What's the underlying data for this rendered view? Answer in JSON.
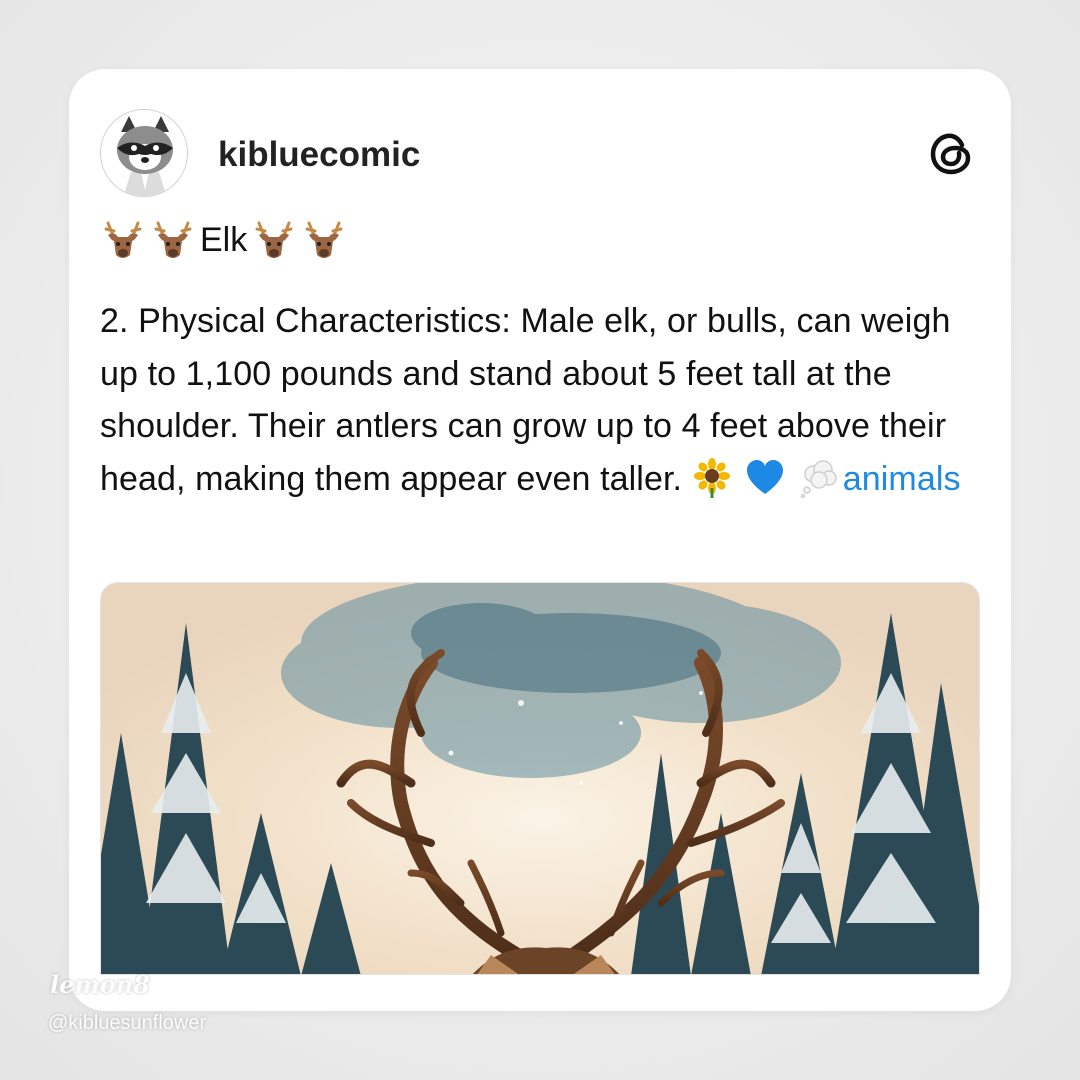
{
  "post": {
    "username": "kibluecomic",
    "title_text": "Elk",
    "body_text": "2. Physical Characteristics: Male elk, or bulls, can weigh up to 1,100 pounds and stand about 5 feet tall at the shoulder. Their antlers can grow up to 4 feet above their head, making them appear even taller.",
    "tag": "animals",
    "title_emoji": "deer-emoji",
    "trailing_emoji": [
      "sunflower-emoji",
      "blue-heart-emoji",
      "thought-balloon-emoji"
    ]
  },
  "icons": {
    "avatar": "raccoon-avatar",
    "app_logo": "threads-logo-icon"
  },
  "watermark": {
    "logo": "lemon8",
    "handle": "@kibluesunflower"
  },
  "colors": {
    "tag_link": "#1f8be0",
    "card_bg": "#ffffff",
    "page_bg": "#ececec"
  }
}
